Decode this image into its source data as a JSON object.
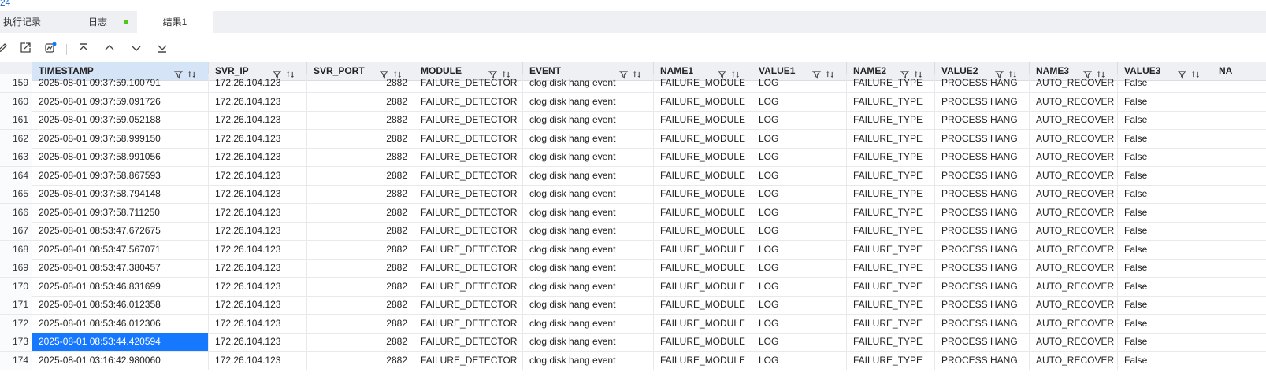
{
  "editor": {
    "line_number": "24"
  },
  "tabs": [
    {
      "label": "执行记录"
    },
    {
      "label": "日志"
    },
    {
      "label": "结果1"
    }
  ],
  "colors": {
    "accent": "#1677ff",
    "running": "#52c41a",
    "header_bg": "#eef0f4"
  },
  "toolbar": {
    "icons": [
      "edit-icon",
      "export-icon",
      "chart-icon",
      "first-row-icon",
      "prev-row-icon",
      "next-row-icon",
      "last-row-icon"
    ]
  },
  "table": {
    "columns": [
      "TIMESTAMP",
      "SVR_IP",
      "SVR_PORT",
      "MODULE",
      "EVENT",
      "NAME1",
      "VALUE1",
      "NAME2",
      "VALUE2",
      "NAME3",
      "VALUE3",
      "NA"
    ],
    "selected_row": "173",
    "rows": [
      [
        "159",
        "2025-08-01 09:37:59.100791",
        "172.26.104.123",
        "2882",
        "FAILURE_DETECTOR",
        "clog disk hang event",
        "FAILURE_MODULE",
        "LOG",
        "FAILURE_TYPE",
        "PROCESS HANG",
        "AUTO_RECOVER",
        "False"
      ],
      [
        "160",
        "2025-08-01 09:37:59.091726",
        "172.26.104.123",
        "2882",
        "FAILURE_DETECTOR",
        "clog disk hang event",
        "FAILURE_MODULE",
        "LOG",
        "FAILURE_TYPE",
        "PROCESS HANG",
        "AUTO_RECOVER",
        "False"
      ],
      [
        "161",
        "2025-08-01 09:37:59.052188",
        "172.26.104.123",
        "2882",
        "FAILURE_DETECTOR",
        "clog disk hang event",
        "FAILURE_MODULE",
        "LOG",
        "FAILURE_TYPE",
        "PROCESS HANG",
        "AUTO_RECOVER",
        "False"
      ],
      [
        "162",
        "2025-08-01 09:37:58.999150",
        "172.26.104.123",
        "2882",
        "FAILURE_DETECTOR",
        "clog disk hang event",
        "FAILURE_MODULE",
        "LOG",
        "FAILURE_TYPE",
        "PROCESS HANG",
        "AUTO_RECOVER",
        "False"
      ],
      [
        "163",
        "2025-08-01 09:37:58.991056",
        "172.26.104.123",
        "2882",
        "FAILURE_DETECTOR",
        "clog disk hang event",
        "FAILURE_MODULE",
        "LOG",
        "FAILURE_TYPE",
        "PROCESS HANG",
        "AUTO_RECOVER",
        "False"
      ],
      [
        "164",
        "2025-08-01 09:37:58.867593",
        "172.26.104.123",
        "2882",
        "FAILURE_DETECTOR",
        "clog disk hang event",
        "FAILURE_MODULE",
        "LOG",
        "FAILURE_TYPE",
        "PROCESS HANG",
        "AUTO_RECOVER",
        "False"
      ],
      [
        "165",
        "2025-08-01 09:37:58.794148",
        "172.26.104.123",
        "2882",
        "FAILURE_DETECTOR",
        "clog disk hang event",
        "FAILURE_MODULE",
        "LOG",
        "FAILURE_TYPE",
        "PROCESS HANG",
        "AUTO_RECOVER",
        "False"
      ],
      [
        "166",
        "2025-08-01 09:37:58.711250",
        "172.26.104.123",
        "2882",
        "FAILURE_DETECTOR",
        "clog disk hang event",
        "FAILURE_MODULE",
        "LOG",
        "FAILURE_TYPE",
        "PROCESS HANG",
        "AUTO_RECOVER",
        "False"
      ],
      [
        "167",
        "2025-08-01 08:53:47.672675",
        "172.26.104.123",
        "2882",
        "FAILURE_DETECTOR",
        "clog disk hang event",
        "FAILURE_MODULE",
        "LOG",
        "FAILURE_TYPE",
        "PROCESS HANG",
        "AUTO_RECOVER",
        "False"
      ],
      [
        "168",
        "2025-08-01 08:53:47.567071",
        "172.26.104.123",
        "2882",
        "FAILURE_DETECTOR",
        "clog disk hang event",
        "FAILURE_MODULE",
        "LOG",
        "FAILURE_TYPE",
        "PROCESS HANG",
        "AUTO_RECOVER",
        "False"
      ],
      [
        "169",
        "2025-08-01 08:53:47.380457",
        "172.26.104.123",
        "2882",
        "FAILURE_DETECTOR",
        "clog disk hang event",
        "FAILURE_MODULE",
        "LOG",
        "FAILURE_TYPE",
        "PROCESS HANG",
        "AUTO_RECOVER",
        "False"
      ],
      [
        "170",
        "2025-08-01 08:53:46.831699",
        "172.26.104.123",
        "2882",
        "FAILURE_DETECTOR",
        "clog disk hang event",
        "FAILURE_MODULE",
        "LOG",
        "FAILURE_TYPE",
        "PROCESS HANG",
        "AUTO_RECOVER",
        "False"
      ],
      [
        "171",
        "2025-08-01 08:53:46.012358",
        "172.26.104.123",
        "2882",
        "FAILURE_DETECTOR",
        "clog disk hang event",
        "FAILURE_MODULE",
        "LOG",
        "FAILURE_TYPE",
        "PROCESS HANG",
        "AUTO_RECOVER",
        "False"
      ],
      [
        "172",
        "2025-08-01 08:53:46.012306",
        "172.26.104.123",
        "2882",
        "FAILURE_DETECTOR",
        "clog disk hang event",
        "FAILURE_MODULE",
        "LOG",
        "FAILURE_TYPE",
        "PROCESS HANG",
        "AUTO_RECOVER",
        "False"
      ],
      [
        "173",
        "2025-08-01 08:53:44.420594",
        "172.26.104.123",
        "2882",
        "FAILURE_DETECTOR",
        "clog disk hang event",
        "FAILURE_MODULE",
        "LOG",
        "FAILURE_TYPE",
        "PROCESS HANG",
        "AUTO_RECOVER",
        "False"
      ],
      [
        "174",
        "2025-08-01 03:16:42.980060",
        "172.26.104.123",
        "2882",
        "FAILURE_DETECTOR",
        "clog disk hang event",
        "FAILURE_MODULE",
        "LOG",
        "FAILURE_TYPE",
        "PROCESS HANG",
        "AUTO_RECOVER",
        "False"
      ]
    ]
  }
}
